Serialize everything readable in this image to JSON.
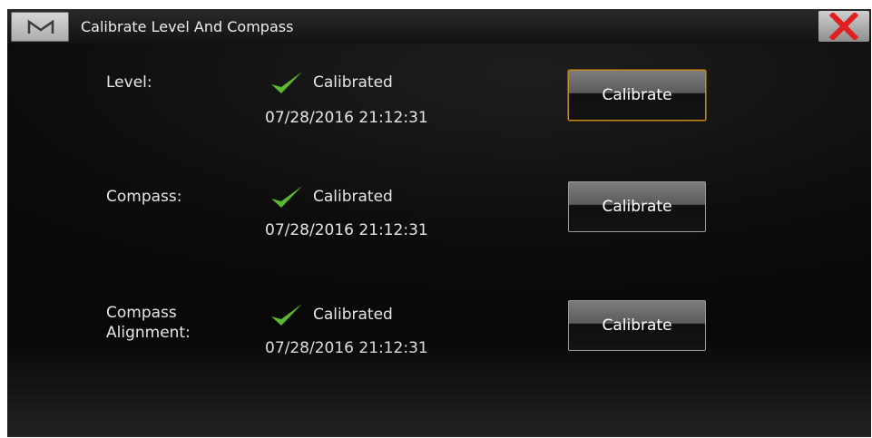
{
  "window": {
    "title": "Calibrate Level And Compass",
    "menu_icon": "M",
    "close_icon": "close-x-icon"
  },
  "rows": [
    {
      "label": "Level:",
      "status": "Calibrated",
      "timestamp": "07/28/2016 21:12:31",
      "button_label": "Calibrate",
      "focused": true
    },
    {
      "label": "Compass:",
      "status": "Calibrated",
      "timestamp": "07/28/2016 21:12:31",
      "button_label": "Calibrate",
      "focused": false
    },
    {
      "label_line1": "Compass",
      "label_line2": "Alignment:",
      "status": "Calibrated",
      "timestamp": "07/28/2016 21:12:31",
      "button_label": "Calibrate",
      "focused": false
    }
  ],
  "colors": {
    "check_green": "#5cb82e",
    "focus_border": "#c48a20",
    "close_red": "#e02020"
  }
}
